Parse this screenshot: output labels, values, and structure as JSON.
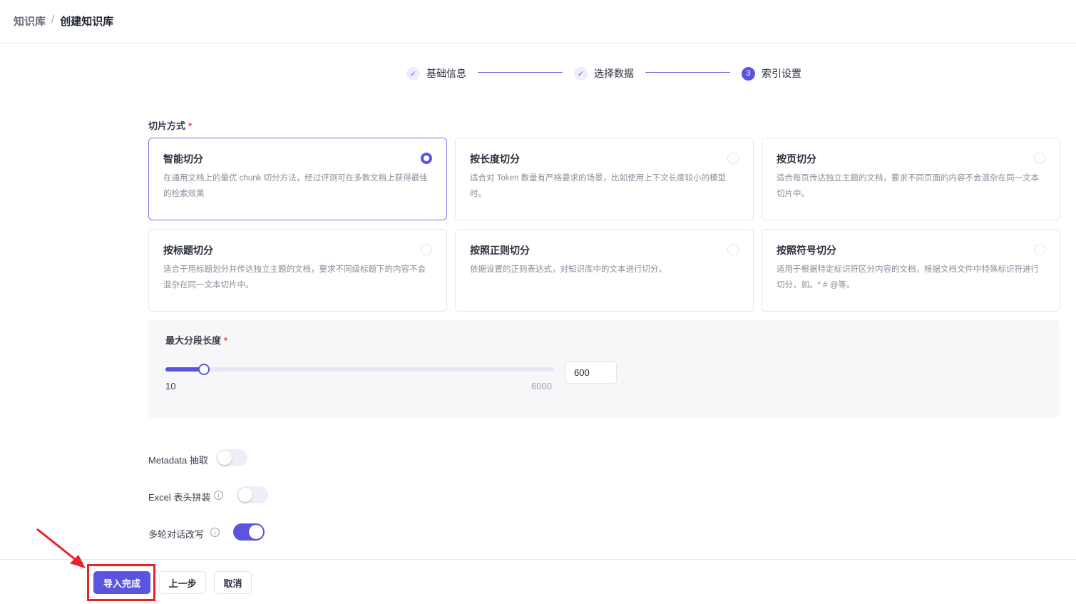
{
  "breadcrumb": {
    "parent": "知识库",
    "separator": "/",
    "current": "创建知识库"
  },
  "steps": [
    {
      "label": "基础信息",
      "icon": "check-icon",
      "status": "done"
    },
    {
      "label": "选择数据",
      "icon": "check-icon",
      "status": "done"
    },
    {
      "label": "索引设置",
      "number": "3",
      "status": "active"
    }
  ],
  "chunk_method": {
    "label": "切片方式",
    "required": "*",
    "options": [
      {
        "title": "智能切分",
        "desc": "在通用文档上的最优 chunk 切分方法，经过评测可在多数文档上获得最佳的检索效果",
        "selected": true
      },
      {
        "title": "按长度切分",
        "desc": "适合对 Token 数量有严格要求的场景，比如使用上下文长度较小的模型时。",
        "selected": false
      },
      {
        "title": "按页切分",
        "desc": "适合每页传达独立主题的文档，要求不同页面的内容不会混杂在同一文本切片中。",
        "selected": false
      },
      {
        "title": "按标题切分",
        "desc": "适合于用标题划分并传达独立主题的文档，要求不同级标题下的内容不会混杂在同一文本切片中。",
        "selected": false
      },
      {
        "title": "按照正则切分",
        "desc": "依据设置的正则表达式，对知识库中的文本进行切分。",
        "selected": false
      },
      {
        "title": "按照符号切分",
        "desc": "适用于根据特定标识符区分内容的文档，根据文档文件中特殊标识符进行切分，如。* # @等。",
        "selected": false
      }
    ]
  },
  "max_length": {
    "label": "最大分段长度",
    "required": "*",
    "min": "10",
    "max": "6000",
    "value": "600",
    "fraction": 0.0985
  },
  "toggles": [
    {
      "label": "Metadata 抽取",
      "info": false,
      "on": false
    },
    {
      "label": "Excel 表头拼装",
      "info": true,
      "on": false
    },
    {
      "label": "多轮对话改写",
      "info": true,
      "on": true
    }
  ],
  "info_glyph": "i",
  "footer": {
    "finish": "导入完成",
    "prev": "上一步",
    "cancel": "取消"
  },
  "colors": {
    "accent": "#5b54e0",
    "annotation": "#e8222a"
  }
}
